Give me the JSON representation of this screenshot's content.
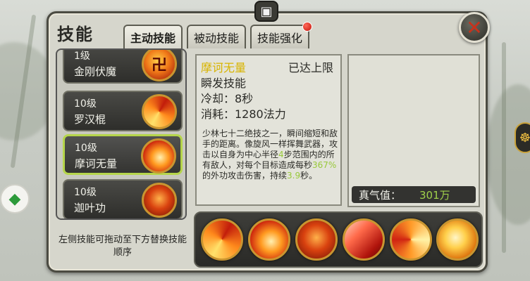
{
  "window": {
    "title": "技能"
  },
  "tabs": [
    {
      "label": "主动技能",
      "active": true
    },
    {
      "label": "被动技能",
      "active": false
    },
    {
      "label": "技能强化",
      "active": false,
      "notification": true
    }
  ],
  "skill_list": [
    {
      "level": "1级",
      "name": "金刚伏魔",
      "icon": "swastika-icon"
    },
    {
      "level": "10级",
      "name": "罗汉棍",
      "icon": "staff-icon"
    },
    {
      "level": "10级",
      "name": "摩诃无量",
      "icon": "swirl-icon",
      "selected": true
    },
    {
      "level": "10级",
      "name": "迦叶功",
      "icon": "fiery-face-icon"
    }
  ],
  "hint": "左侧技能可拖动至下方替换技能顺序",
  "detail": {
    "name": "摩诃无量",
    "status": "已达上限",
    "type": "瞬发技能",
    "cooldown": "冷却：8秒",
    "cost": "消耗：1280法力",
    "desc_1": "少林七十二绝技之一，瞬间缩短和敌手的距离。像旋风一样挥舞武器，攻击以自身为中心半径",
    "desc_hl_1": "4",
    "desc_2": "步范围内的所有敌人，对每个目标造成每秒",
    "desc_hl_2": "367%",
    "desc_3": "的外功攻击伤害，持续",
    "desc_hl_3": "3.9",
    "desc_4": "秒。"
  },
  "qi": {
    "label": "真气值：",
    "value": "301万"
  },
  "skill_bar": [
    "staff-icon",
    "swirl-icon",
    "fiery-face-icon",
    "blade-icon",
    "arrow-icon",
    "golden-orb-icon"
  ],
  "colors": {
    "accent_yellow": "#d8b400",
    "highlight_green": "#98c83a",
    "selected_border": "#b5d54a",
    "notification_red": "#c4140a"
  }
}
